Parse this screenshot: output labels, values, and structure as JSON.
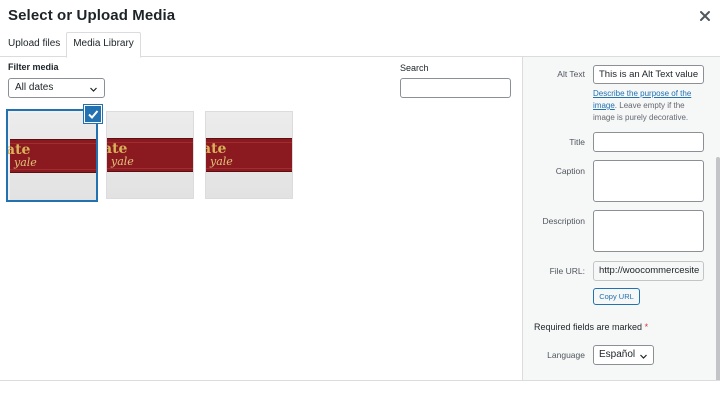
{
  "modal": {
    "title": "Select or Upload Media"
  },
  "tabs": [
    {
      "label": "Upload files"
    },
    {
      "label": "Media Library"
    }
  ],
  "filter": {
    "label": "Filter media",
    "date_value": "All dates"
  },
  "search": {
    "label": "Search",
    "value": ""
  },
  "attachments": [
    {
      "logo_line1": "ate",
      "logo_line2": "yale",
      "selected": true
    },
    {
      "logo_line1": "ate",
      "logo_line2": "yale",
      "selected": false
    },
    {
      "logo_line1": "ate",
      "logo_line2": "yale",
      "selected": false
    }
  ],
  "details": {
    "alt_text": {
      "label": "Alt Text",
      "value": "This is an Alt Text value"
    },
    "alt_help_link": "Describe the purpose of the image",
    "alt_help_rest": ". Leave empty if the image is purely decorative.",
    "title": {
      "label": "Title",
      "value": ""
    },
    "caption": {
      "label": "Caption",
      "value": ""
    },
    "description": {
      "label": "Description",
      "value": ""
    },
    "file_url": {
      "label": "File URL:",
      "value": "http://woocommercesite"
    },
    "copy_url_label": "Copy URL",
    "required_note": "Required fields are marked",
    "required_star": "*",
    "language": {
      "label": "Language",
      "value": "Español"
    }
  },
  "colors": {
    "accent": "#2271b1",
    "required": "#d63638",
    "sidebar_bg": "#f6f7f7"
  },
  "icons": {
    "close": "close-icon",
    "check": "check-icon",
    "chevron": "chevron-down-icon"
  }
}
